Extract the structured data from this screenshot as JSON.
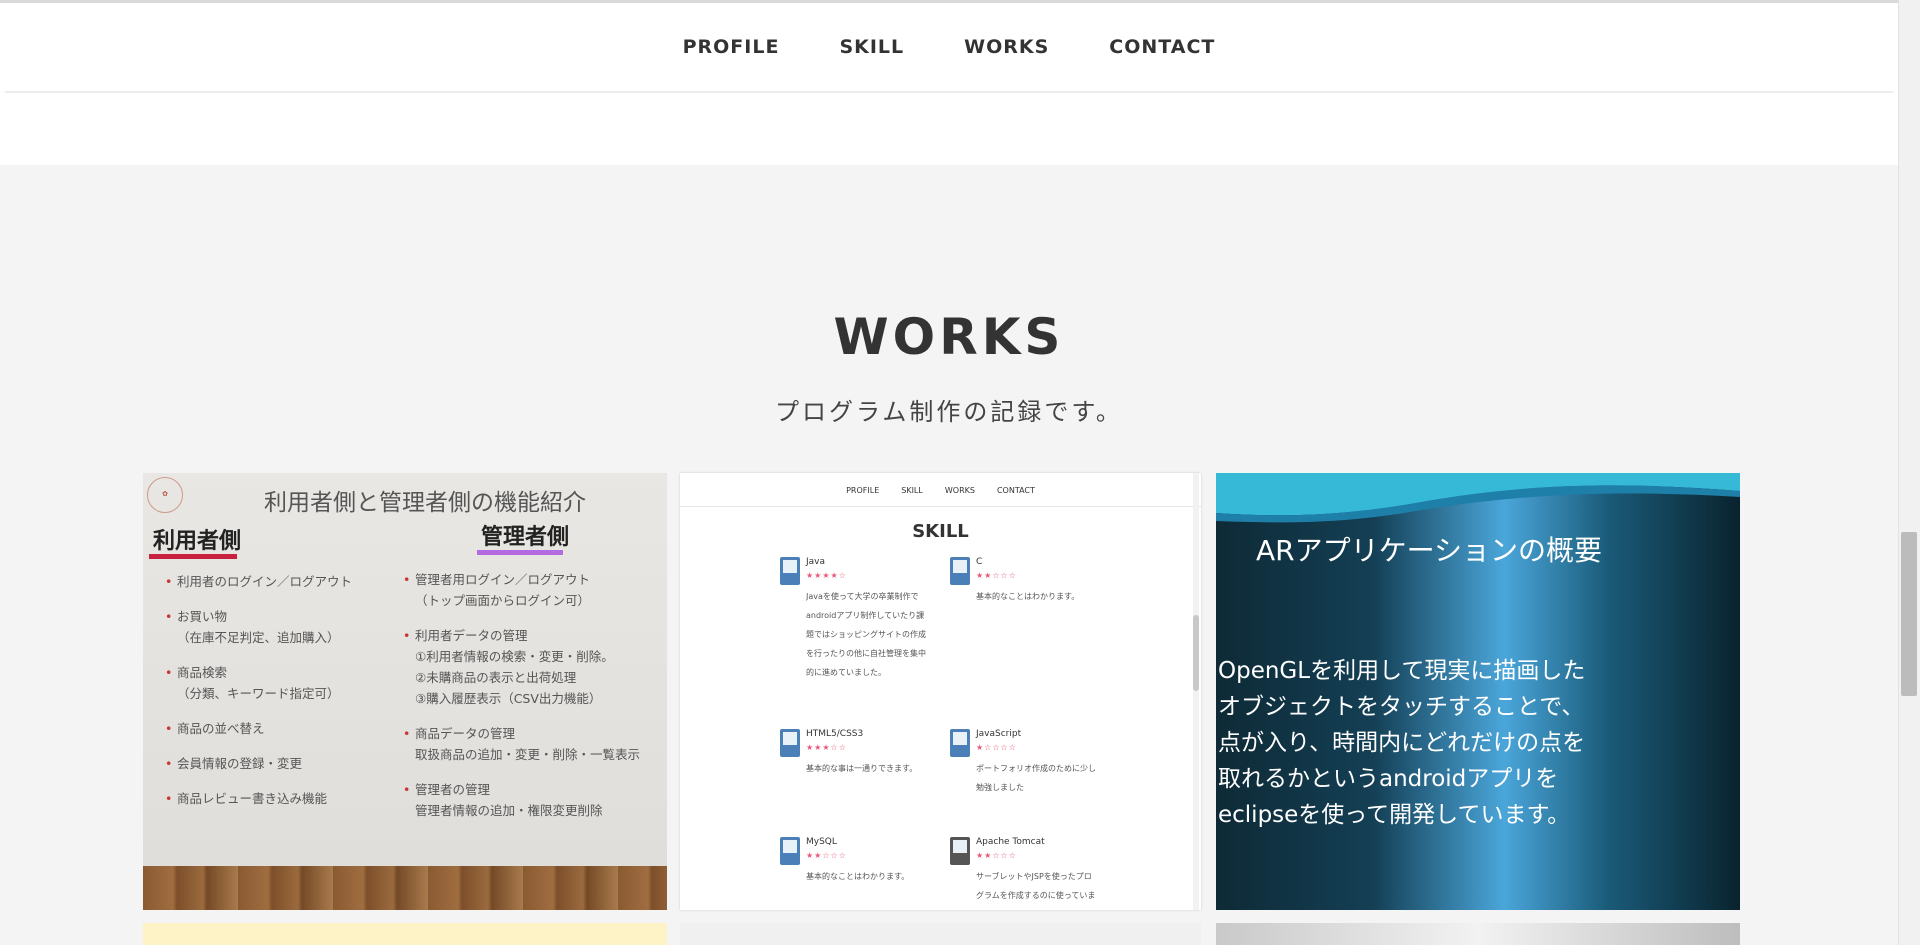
{
  "nav": {
    "items": [
      "PROFILE",
      "SKILL",
      "WORKS",
      "CONTACT"
    ]
  },
  "works": {
    "title": "WORKS",
    "subtitle": "プログラム制作の記録です。"
  },
  "card1": {
    "title": "利用者側と管理者側の機能紹介",
    "user_heading": "利用者側",
    "admin_heading": "管理者側",
    "user_items": [
      "利用者のログイン／ログアウト",
      "お買い物\n（在庫不足判定、追加購入）",
      "商品検索\n（分類、キーワード指定可）",
      "商品の並べ替え",
      "会員情報の登録・変更",
      "商品レビュー書き込み機能"
    ],
    "admin_items": [
      "管理者用ログイン／ログアウト\n（トップ画面からログイン可）",
      "利用者データの管理\n①利用者情報の検索・変更・削除。\n②未購商品の表示と出荷処理\n③購入履歴表示（CSV出力機能）",
      "商品データの管理\n取扱商品の追加・変更・削除・一覧表示",
      "管理者の管理\n管理者情報の追加・権限変更削除"
    ],
    "colors": {
      "user_underline": "#c8213f",
      "admin_underline": "#b46ae0"
    }
  },
  "card2": {
    "nav": [
      "PROFILE",
      "SKILL",
      "WORKS",
      "CONTACT"
    ],
    "title": "SKILL",
    "skills": [
      {
        "name": "Java",
        "stars": "★★★★☆",
        "desc": "Javaを使って大学の卒業制作でandroidアプリ制作していたり課題ではショッピングサイトの作成を行ったりの他に自社管理を集中的に進めていました。"
      },
      {
        "name": "C",
        "stars": "★★☆☆☆",
        "desc": "基本的なことはわかります。"
      },
      {
        "name": "HTML5/CSS3",
        "stars": "★★★☆☆",
        "desc": "基本的な事は一通りできます。"
      },
      {
        "name": "JavaScript",
        "stars": "★☆☆☆☆",
        "desc": "ポートフォリオ作成のために少し勉強しました"
      },
      {
        "name": "MySQL",
        "stars": "★★☆☆☆",
        "desc": "基本的なことはわかります。"
      },
      {
        "name": "Apache Tomcat",
        "stars": "★★☆☆☆",
        "desc": "サーブレットやJSPを使ったプログラムを作成するのに使っています"
      }
    ]
  },
  "card3": {
    "title": "ARアプリケーションの概要",
    "body": "OpenGLを利用して現実に描画したオブジェクトをタッチすることで、点が入り、時間内にどれだけの点を取れるかというandroidアプリをeclipseを使って開発しています。"
  }
}
